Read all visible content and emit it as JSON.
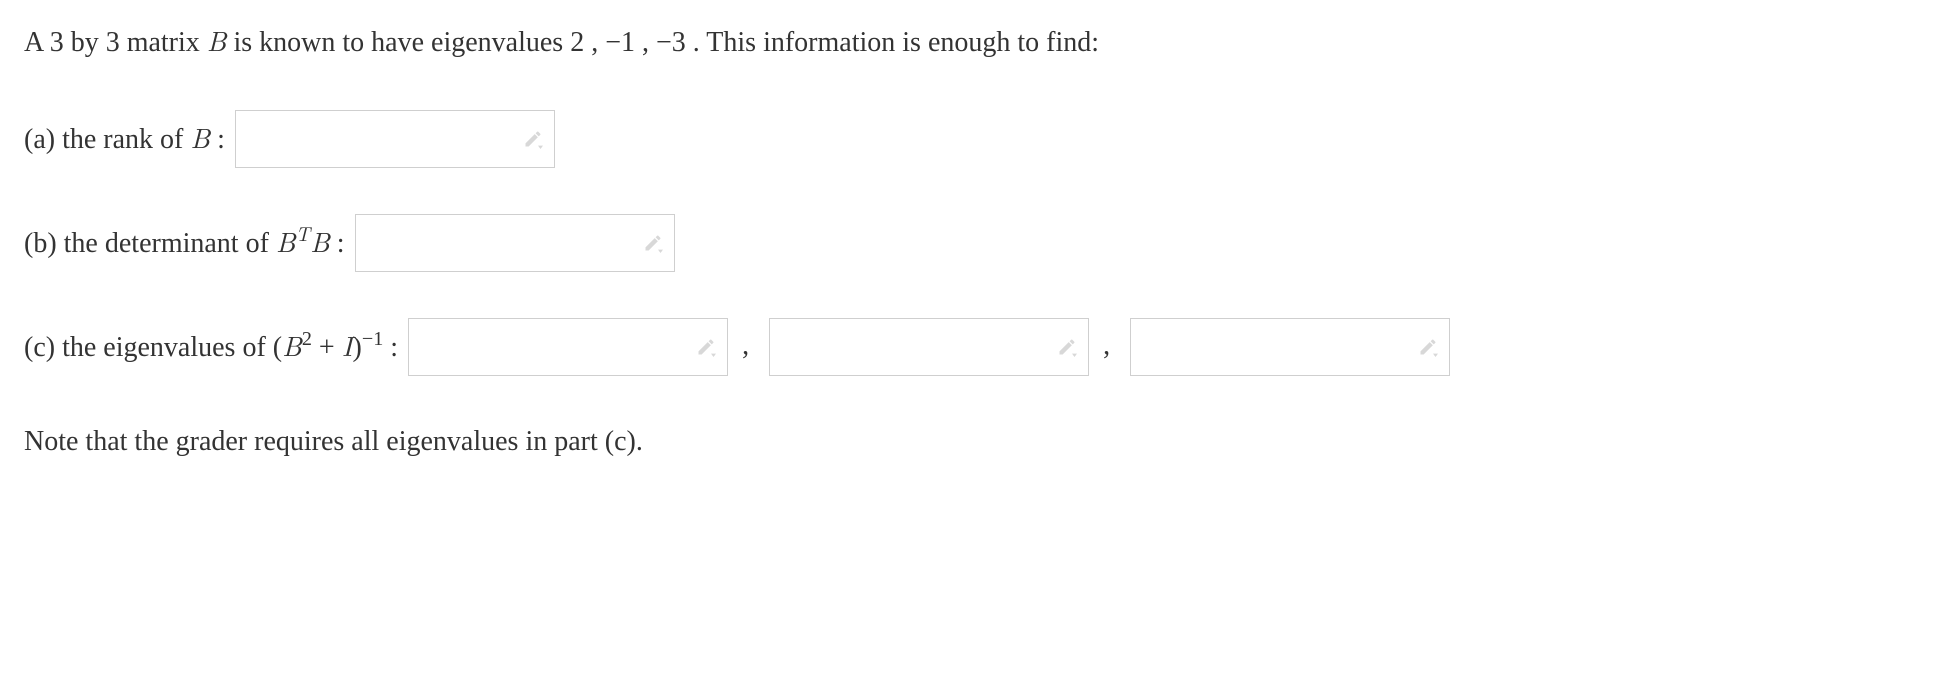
{
  "prompt": {
    "pre": "A ",
    "m1": "3",
    "mid1": " by ",
    "m2": "3",
    "mid2": " matrix ",
    "B": "B",
    "mid3": " is known to have eigenvalues ",
    "ev1": "2",
    "sep1": ", ",
    "ev2": "−1",
    "sep2": ", ",
    "ev3": "−3",
    "post": ". This information is enough to find:"
  },
  "a": {
    "pre": "(a) the rank of ",
    "B": "B",
    "post": ":"
  },
  "b": {
    "pre": "(b) the determinant of ",
    "B": "B",
    "T": "T",
    "B2": "B",
    "post": ":"
  },
  "c": {
    "pre": "(c) the eigenvalues of ",
    "lpar": "(",
    "B": "B",
    "two": "2",
    "plus": " + ",
    "I": "I",
    "rpar": ")",
    "neg1": "−1",
    "post": ":",
    "comma": ","
  },
  "note": "Note that the grader requires all eigenvalues in part (c).",
  "inputs": {
    "a": "",
    "b": "",
    "c1": "",
    "c2": "",
    "c3": ""
  }
}
